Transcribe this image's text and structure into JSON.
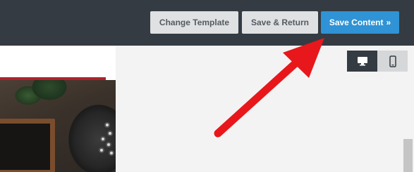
{
  "toolbar": {
    "change_template_label": "Change Template",
    "save_return_label": "Save & Return",
    "save_content_label": "Save Content",
    "save_content_chevron": "»"
  },
  "view_toggle": {
    "desktop_icon": "desktop-monitor-icon",
    "mobile_icon": "mobile-phone-icon",
    "selected": "desktop"
  },
  "colors": {
    "topbar": "#343b42",
    "primary": "#2f93d5",
    "accent_rule": "#b0212c",
    "annotation_arrow": "#e8171b"
  }
}
